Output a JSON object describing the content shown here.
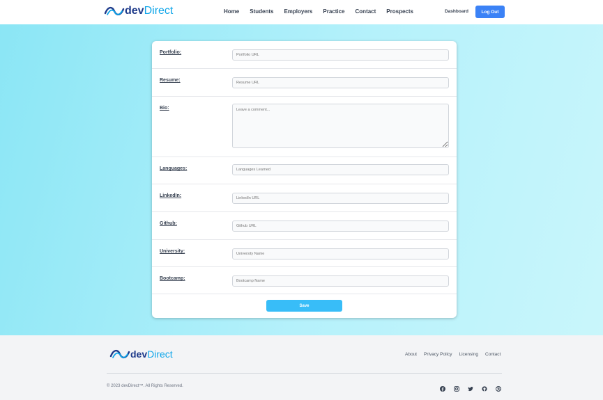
{
  "brand": {
    "name_part1": "dev",
    "name_part2": "Direct"
  },
  "nav": {
    "items": [
      "Home",
      "Students",
      "Employers",
      "Practice",
      "Contact",
      "Prospects"
    ],
    "dashboard": "Dashboard",
    "logout": "Log Out"
  },
  "form": {
    "fields": [
      {
        "label": "Portfolio:",
        "placeholder": "Portfolio URL"
      },
      {
        "label": "Resume:",
        "placeholder": "Resume URL"
      },
      {
        "label": "Bio:",
        "placeholder": "Leave a comment..."
      },
      {
        "label": "Languages:",
        "placeholder": "Languages Learned"
      },
      {
        "label": "LinkedIn:",
        "placeholder": "LinkedIn URL"
      },
      {
        "label": "Github:",
        "placeholder": "Github URL"
      },
      {
        "label": "University:",
        "placeholder": "University Name"
      },
      {
        "label": "Bootcamp:",
        "placeholder": "Bootcamp Name"
      }
    ],
    "save": "Save"
  },
  "footer": {
    "links": [
      "About",
      "Privacy Policy",
      "Licensing",
      "Contact"
    ],
    "copyright": "© 2023 devDirect™. All Rights Reserved.",
    "socials": [
      "facebook-icon",
      "instagram-icon",
      "twitter-icon",
      "github-icon",
      "dribbble-icon"
    ]
  },
  "colors": {
    "brand_dark": "#1e3a8a",
    "brand_light": "#0ea5e9",
    "logout_button": "#3b82f6",
    "save_button": "#38bdf8"
  }
}
